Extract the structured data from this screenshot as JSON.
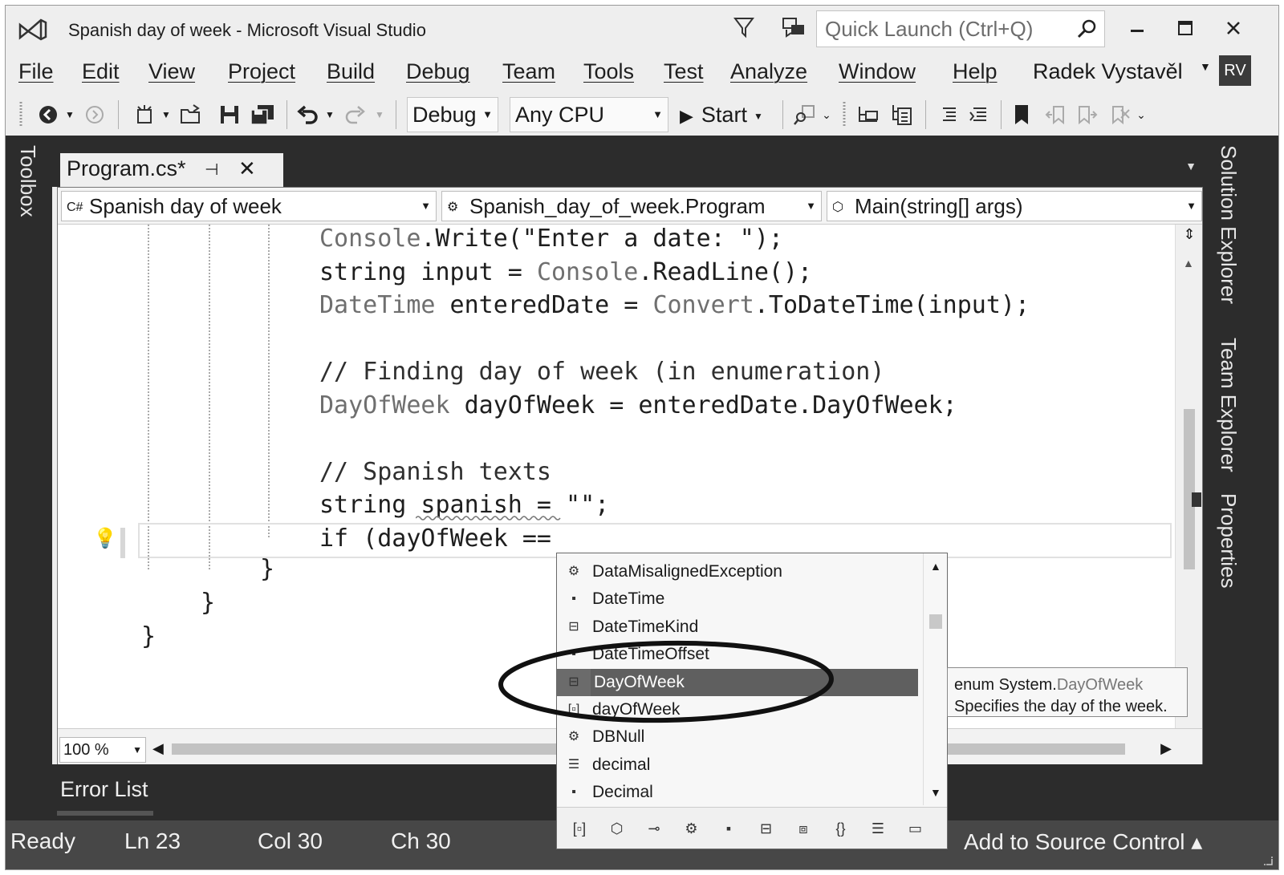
{
  "window": {
    "title": "Spanish day of week - Microsoft Visual Studio",
    "quick_launch_placeholder": "Quick Launch (Ctrl+Q)",
    "controls": [
      "−",
      "□",
      "✕"
    ]
  },
  "menu": {
    "items": [
      "File",
      "Edit",
      "View",
      "Project",
      "Build",
      "Debug",
      "Team",
      "Tools",
      "Test",
      "Analyze",
      "Window",
      "Help"
    ],
    "user_name": "Radek Vystavěl",
    "user_initials": "RV"
  },
  "toolbar": {
    "configuration": "Debug",
    "platform": "Any CPU",
    "start_label": "Start"
  },
  "side_tabs": {
    "left": "Toolbox",
    "right": [
      "Solution Explorer",
      "Team Explorer",
      "Properties"
    ]
  },
  "document_tab": {
    "label": "Program.cs*"
  },
  "navbar": {
    "project": "Spanish day of week",
    "class": "Spanish_day_of_week.Program",
    "member": "Main(string[] args)"
  },
  "code": {
    "lines": [
      {
        "parts": [
          {
            "t": "Console",
            "c": "type"
          },
          {
            "t": ".Write(\"Enter a date: \");",
            "c": ""
          }
        ]
      },
      {
        "parts": [
          {
            "t": "string input = ",
            "c": ""
          },
          {
            "t": "Console",
            "c": "type"
          },
          {
            "t": ".ReadLine();",
            "c": ""
          }
        ]
      },
      {
        "parts": [
          {
            "t": "DateTime",
            "c": "type"
          },
          {
            "t": " enteredDate = ",
            "c": ""
          },
          {
            "t": "Convert",
            "c": "type"
          },
          {
            "t": ".ToDateTime(input);",
            "c": ""
          }
        ]
      },
      {
        "parts": []
      },
      {
        "parts": [
          {
            "t": "// Finding day of week (in enumeration)",
            "c": "cmt"
          }
        ]
      },
      {
        "parts": [
          {
            "t": "DayOfWeek",
            "c": "type"
          },
          {
            "t": " dayOfWeek = enteredDate.DayOfWeek;",
            "c": ""
          }
        ]
      },
      {
        "parts": []
      },
      {
        "parts": [
          {
            "t": "// Spanish texts",
            "c": "cmt"
          }
        ]
      },
      {
        "parts": [
          {
            "t": "string spanish = \"\";",
            "c": ""
          }
        ]
      },
      {
        "parts": [
          {
            "t": "if (dayOfWeek == ",
            "c": ""
          }
        ]
      }
    ],
    "closing_braces": [
      "}",
      "}",
      "}"
    ]
  },
  "editor_footer": {
    "zoom": "100 %"
  },
  "intellisense": {
    "items": [
      {
        "label": "DataMisalignedException",
        "icon": "class-icon",
        "glyph": "⚙"
      },
      {
        "label": "DateTime",
        "icon": "struct-icon",
        "glyph": "▪"
      },
      {
        "label": "DateTimeKind",
        "icon": "enum-icon",
        "glyph": "⊟"
      },
      {
        "label": "DateTimeOffset",
        "icon": "struct-icon",
        "glyph": "▪"
      },
      {
        "label": "DayOfWeek",
        "icon": "enum-icon",
        "glyph": "⊟",
        "selected": true
      },
      {
        "label": "dayOfWeek",
        "icon": "local-variable-icon",
        "glyph": "[▫]"
      },
      {
        "label": "DBNull",
        "icon": "class-icon",
        "glyph": "⚙"
      },
      {
        "label": "decimal",
        "icon": "keyword-icon",
        "glyph": "☰"
      },
      {
        "label": "Decimal",
        "icon": "struct-icon",
        "glyph": "▪"
      }
    ],
    "filters": [
      {
        "icon": "local-variable-filter-icon",
        "glyph": "[▫]"
      },
      {
        "icon": "namespace-filter-icon",
        "glyph": "⬡"
      },
      {
        "icon": "interface-filter-icon",
        "glyph": "⊸"
      },
      {
        "icon": "class-filter-icon",
        "glyph": "⚙"
      },
      {
        "icon": "struct-filter-icon",
        "glyph": "▪"
      },
      {
        "icon": "enum-filter-icon",
        "glyph": "⊟"
      },
      {
        "icon": "delegate-filter-icon",
        "glyph": "⧈"
      },
      {
        "icon": "snippet-filter-icon",
        "glyph": "{}"
      },
      {
        "icon": "keyword-filter-icon",
        "glyph": "☰"
      },
      {
        "icon": "expand-filter-icon",
        "glyph": "▭"
      }
    ]
  },
  "tooltip": {
    "prefix": "enum System.",
    "name": "DayOfWeek",
    "description": "Specifies the day of the week."
  },
  "bottom_panel": {
    "tab": "Error List"
  },
  "status": {
    "ready": "Ready",
    "line": "Ln 23",
    "col": "Col 30",
    "ch": "Ch 30",
    "source_control": "Add to Source Control ▴"
  }
}
